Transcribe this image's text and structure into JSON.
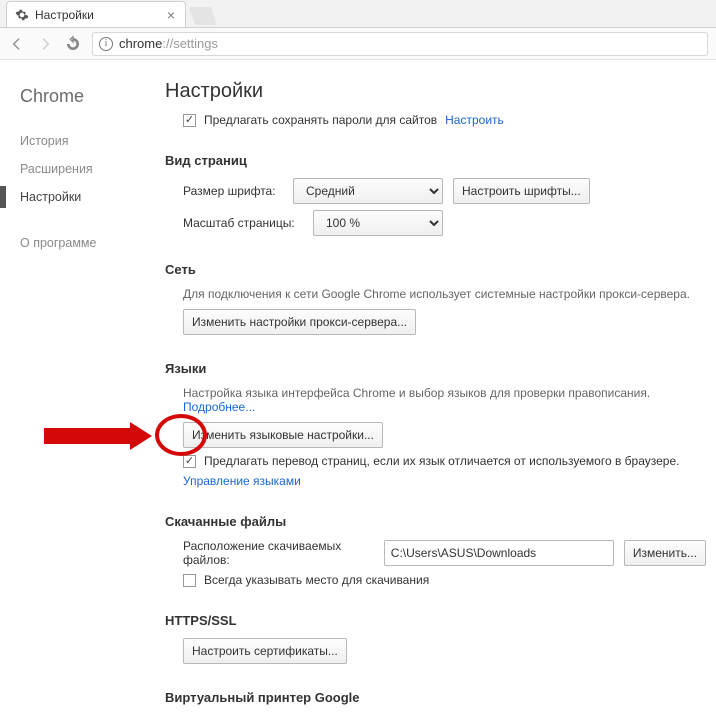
{
  "browser": {
    "tab_title": "Настройки",
    "url_host": "chrome",
    "url_path": "://settings"
  },
  "sidebar": {
    "brand": "Chrome",
    "items": [
      "История",
      "Расширения",
      "Настройки"
    ],
    "active_index": 2,
    "about": "О программе"
  },
  "page": {
    "title": "Настройки"
  },
  "passwords": {
    "offer_label": "Предлагать сохранять пароли для сайтов",
    "configure_link": "Настроить",
    "checked": true
  },
  "appearance": {
    "header": "Вид страниц",
    "font_label": "Размер шрифта:",
    "font_options": [
      "Средний"
    ],
    "font_value": "Средний",
    "font_button": "Настроить шрифты...",
    "zoom_label": "Масштаб страницы:",
    "zoom_options": [
      "100 %"
    ],
    "zoom_value": "100 %"
  },
  "network": {
    "header": "Сеть",
    "desc": "Для подключения к сети Google Chrome использует системные настройки прокси-сервера.",
    "button": "Изменить настройки прокси-сервера..."
  },
  "languages": {
    "header": "Языки",
    "desc": "Настройка языка интерфейса Chrome и выбор языков для проверки правописания.",
    "more_link": "Подробнее...",
    "button": "Изменить языковые настройки...",
    "translate_checked": true,
    "translate_label": "Предлагать перевод страниц, если их язык отличается от используемого в браузере.",
    "manage_link": "Управление языками"
  },
  "downloads": {
    "header": "Скачанные файлы",
    "location_label": "Расположение скачиваемых файлов:",
    "location_value": "C:\\Users\\ASUS\\Downloads",
    "change_button": "Изменить...",
    "ask_checked": false,
    "ask_label": "Всегда указывать место для скачивания"
  },
  "https": {
    "header": "HTTPS/SSL",
    "button": "Настроить сертификаты..."
  },
  "printer": {
    "header_cut": "Виртуальный принтер Google"
  }
}
